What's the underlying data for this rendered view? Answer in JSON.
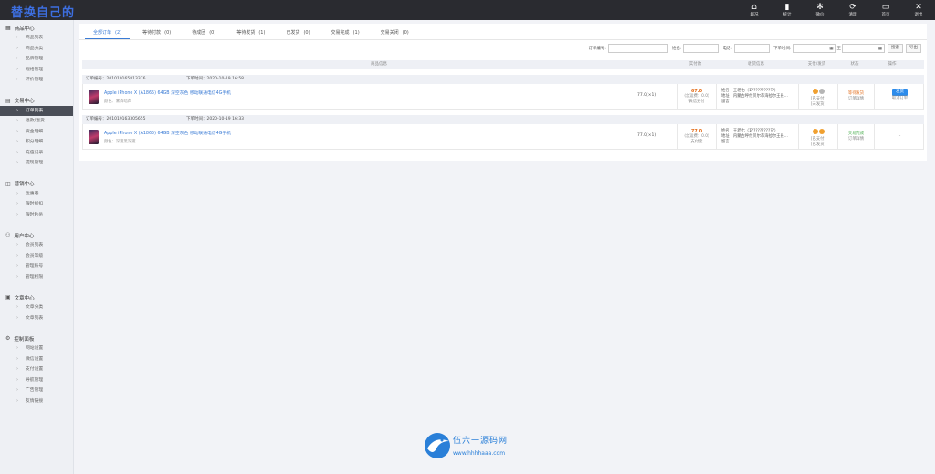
{
  "app": {
    "logo_text": "替换自己的"
  },
  "topnav": [
    {
      "label": "概况",
      "icon": "home-icon",
      "glyph": "⌂"
    },
    {
      "label": "统计",
      "icon": "bar-chart-icon",
      "glyph": "▮"
    },
    {
      "label": "微价",
      "icon": "gear-icon",
      "glyph": "✻"
    },
    {
      "label": "清理",
      "icon": "refresh-icon",
      "glyph": "⟳"
    },
    {
      "label": "首页",
      "icon": "monitor-icon",
      "glyph": "▭"
    },
    {
      "label": "退出",
      "icon": "close-icon",
      "glyph": "✕"
    }
  ],
  "sidebar": {
    "groups": [
      {
        "title": "商品中心",
        "icon": "grid-icon",
        "glyph": "▦",
        "items": [
          "商品列表",
          "商品分类",
          "品牌管理",
          "规格管理",
          "评价管理"
        ]
      },
      {
        "title": "交易中心",
        "icon": "file-icon",
        "glyph": "▤",
        "items": [
          "订单列表",
          "退款/退货",
          "资金明细",
          "积分明细",
          "充值记录",
          "提现管理"
        ]
      },
      {
        "title": "营销中心",
        "icon": "tag-icon",
        "glyph": "◫",
        "items": [
          "优惠券",
          "限时折扣",
          "限时秒杀"
        ]
      },
      {
        "title": "用户中心",
        "icon": "user-icon",
        "glyph": "⚇",
        "items": [
          "会员列表",
          "会员等级",
          "管理账号",
          "管理权限"
        ]
      },
      {
        "title": "文章中心",
        "icon": "doc-icon",
        "glyph": "▣",
        "items": [
          "文章分类",
          "文章列表"
        ]
      },
      {
        "title": "控制面板",
        "icon": "settings-icon",
        "glyph": "⚙",
        "items": [
          "网站设置",
          "微信设置",
          "支付设置",
          "导航管理",
          "广告管理",
          "友情链接"
        ]
      }
    ],
    "active_item": "订单列表"
  },
  "tabs": [
    {
      "label": "全部订单",
      "count": "(2)",
      "active": true
    },
    {
      "label": "等待付款",
      "count": "(0)"
    },
    {
      "label": "待成团",
      "count": "(0)"
    },
    {
      "label": "等待发货",
      "count": "(1)"
    },
    {
      "label": "已发货",
      "count": "(0)"
    },
    {
      "label": "交易完成",
      "count": "(1)"
    },
    {
      "label": "交易关闭",
      "count": "(0)"
    }
  ],
  "filters": {
    "order_no_label": "订单编号:",
    "name_label": "姓名:",
    "phone_label": "电话:",
    "time_label": "下单时间:",
    "date_sep": "至",
    "search_label": "搜索",
    "export_label": "导出"
  },
  "table": {
    "headers": [
      "商品信息",
      "实付款",
      "收货信息",
      "支付/发货",
      "状态",
      "操作"
    ]
  },
  "orders": [
    {
      "order_no": "订单编号：201019165813376",
      "time": "下单时间：2020-10-19 16:58",
      "product": "Apple iPhone X (A1865) 64GB 深空灰色 移动联通电信4G手机",
      "attr": "颜色：雾白暗白",
      "qty": "77.0(×1)",
      "price": "67.0",
      "price_note": "(含运费：0.0)",
      "pay_method": "微信支付",
      "buyer_name": "姓名：王老七（1???????????）",
      "buyer_addr": "地址：内蒙古呼伦贝尔市海拉尔王县...",
      "buyer_msg": "留言：",
      "pay_status": "[已支付]",
      "ship_status": "[未发货]",
      "dot1": "#f0a030",
      "dot2": "#b5b5b5",
      "status": "等待发货",
      "status_sub": "订单详情",
      "status_type": "wait",
      "action": "发货",
      "action_sub": "取消订单"
    },
    {
      "order_no": "订单编号：201019163305655",
      "time": "下单时间：2020-10-19 16:33",
      "product": "Apple iPhone X (A1865) 64GB 深空灰色 移动联通电信4G手机",
      "attr": "颜色：深邃黑深邃",
      "qty": "77.0(×1)",
      "price": "77.0",
      "price_note": "(含运费：0.0)",
      "pay_method": "支付宝",
      "buyer_name": "姓名：王老七（1???????????）",
      "buyer_addr": "地址：内蒙古呼伦贝尔市海拉尔王县...",
      "buyer_msg": "留言：",
      "pay_status": "[已支付]",
      "ship_status": "[已发货]",
      "dot1": "#f0a030",
      "dot2": "#f0a030",
      "status": "交易完成",
      "status_sub": "订单详情",
      "status_type": "done",
      "action": "",
      "action_sub": "-"
    }
  ],
  "watermark": {
    "title": "伍六一源码网",
    "url": "www.hhhhaaa.com"
  }
}
